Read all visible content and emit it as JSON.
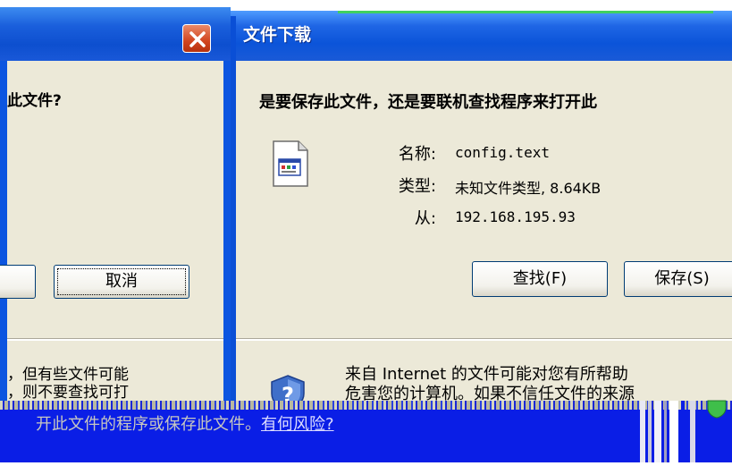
{
  "left_dialog": {
    "question": "此文件?",
    "button_partial_label": "",
    "cancel_label": "取消",
    "info_line_1": "，但有些文件可能",
    "info_line_2": "，则不要查找可打"
  },
  "download_dialog": {
    "title": "文件下载",
    "question": "是要保存此文件，还是要联机查找程序来打开此",
    "fields": {
      "name_label": "名称:",
      "name_value": "config.text",
      "type_label": "类型:",
      "type_value": "未知文件类型, 8.64KB",
      "from_label": "从:",
      "from_value": "192.168.195.93"
    },
    "find_button": "查找(F)",
    "save_button": "保存(S)",
    "info_line_1": "来自 Internet 的文件可能对您有所帮助",
    "info_line_2": "危害您的计算机。如果不信任文件的来源"
  },
  "bottom_band": {
    "text": "开此文件的程序或保存此文件。",
    "risk_link": "有何风险?"
  },
  "colors": {
    "titlebar_blue": "#0b54d9",
    "dialog_bg": "#ece9d8",
    "close_red": "#d2451f",
    "band_blue": "#0a1ee6"
  },
  "icons": {
    "close": "close-icon",
    "file": "unknown-file-icon",
    "shield": "security-shield-icon"
  }
}
